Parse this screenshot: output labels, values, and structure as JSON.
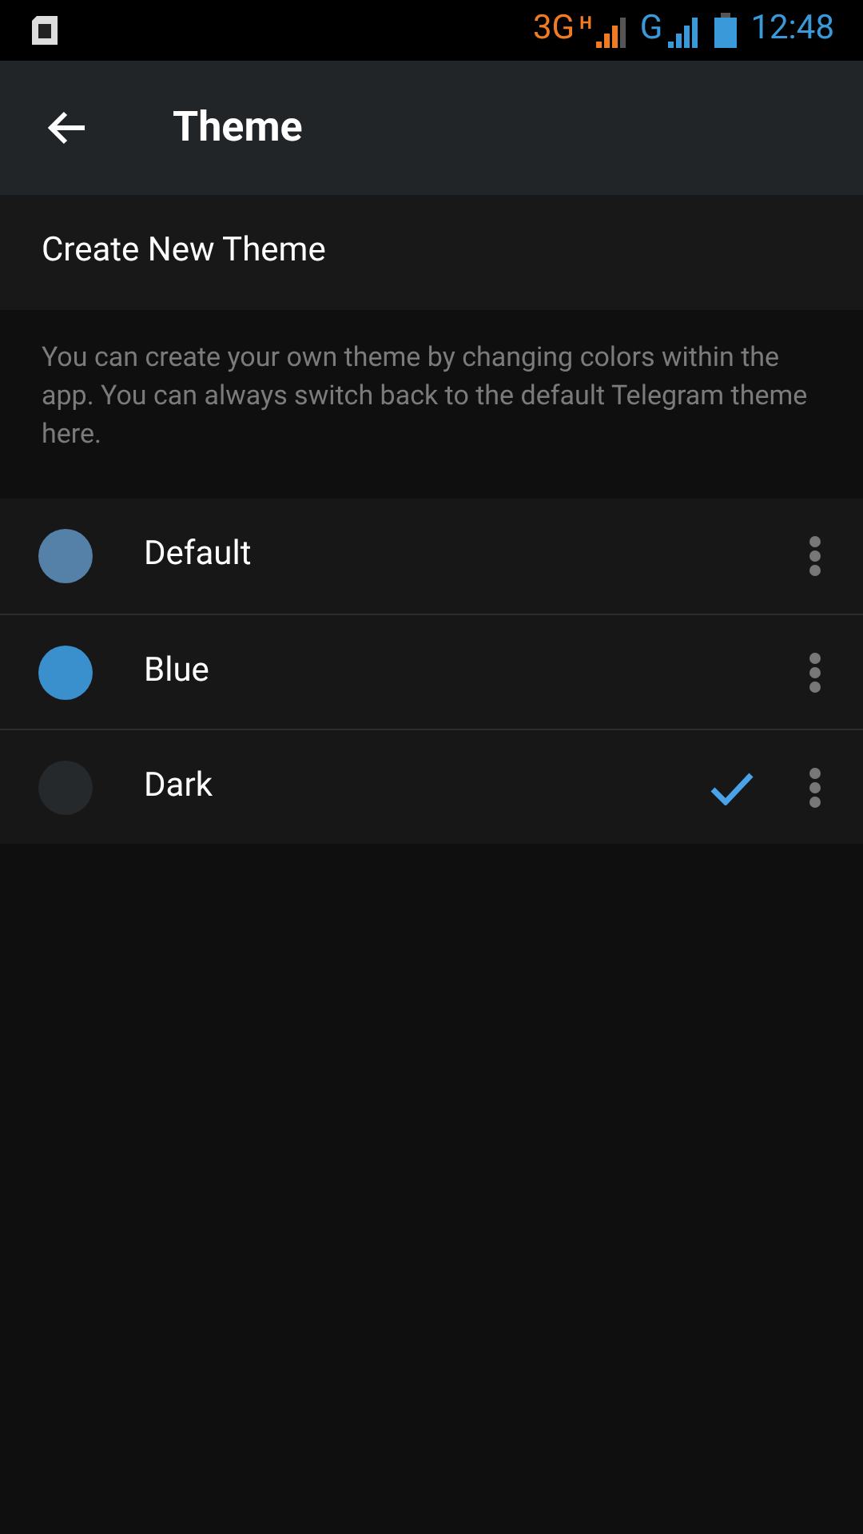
{
  "status_bar": {
    "network_1": "3G",
    "network_1_type": "H",
    "network_2": "G",
    "time": "12:48"
  },
  "header": {
    "title": "Theme"
  },
  "create_theme": {
    "label": "Create New Theme"
  },
  "description": "You can create your own theme by changing colors within the app. You can always switch back to the default Telegram theme here.",
  "themes": [
    {
      "name": "Default",
      "color": "#5581a9",
      "selected": false
    },
    {
      "name": "Blue",
      "color": "#3a8fcd",
      "selected": false
    },
    {
      "name": "Dark",
      "color": "#25292b",
      "selected": true
    }
  ]
}
